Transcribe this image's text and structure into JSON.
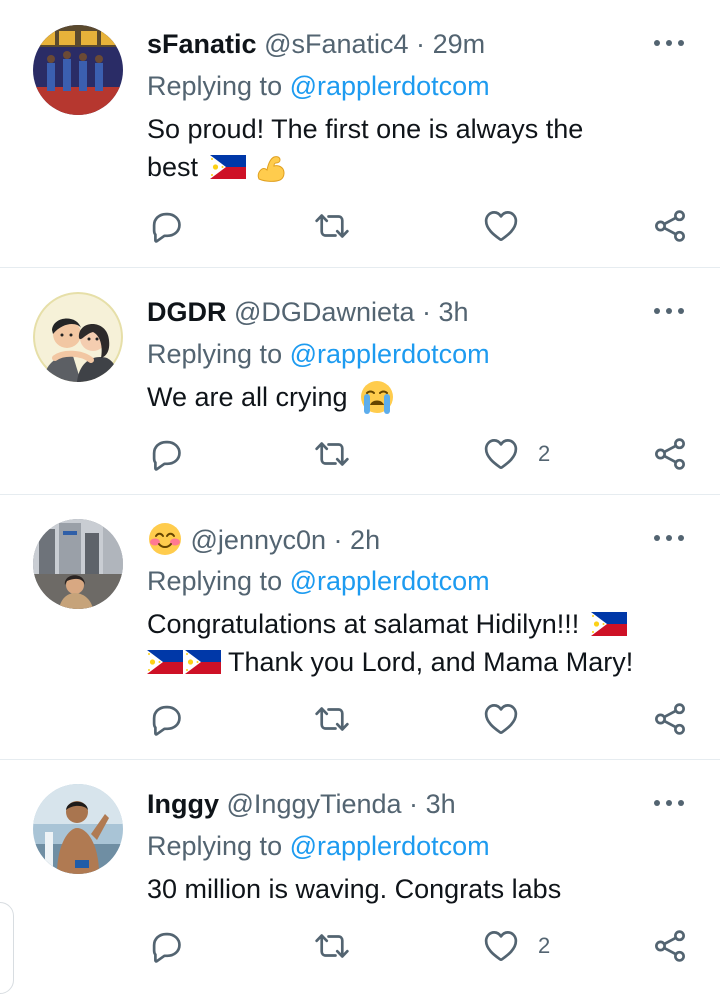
{
  "colors": {
    "text": "#0f1419",
    "muted": "#536471",
    "link": "#1d9bf0",
    "divider": "#e6ecf0",
    "icon": "#536471"
  },
  "tweets": [
    {
      "name": "sFanatic",
      "handle": "@sFanatic4",
      "separator": "·",
      "time": "29m",
      "replying_prefix": "Replying to",
      "replying_to": "@rapplerdotcom",
      "text_line1": "So proud! The first one is always the",
      "text_line2": "best",
      "emojis": [
        "philippines-flag-emoji",
        "flexed-biceps-emoji"
      ],
      "like_count": ""
    },
    {
      "name": "DGDR",
      "handle": "@DGDawnieta",
      "separator": "·",
      "time": "3h",
      "replying_prefix": "Replying to",
      "replying_to": "@rapplerdotcom",
      "text": "We are all crying",
      "emojis": [
        "loudly-crying-face-emoji"
      ],
      "like_count": "2"
    },
    {
      "name": "",
      "name_emoji": "smiling-face-with-hearts-emoji",
      "handle": "@jennyc0n",
      "separator": "·",
      "time": "2h",
      "replying_prefix": "Replying to",
      "replying_to": "@rapplerdotcom",
      "text_line1": "Congratulations at salamat Hidilyn!!!",
      "text_line2": "Thank you Lord, and Mama Mary!",
      "emojis": [
        "philippines-flag-emoji",
        "philippines-flag-emoji",
        "philippines-flag-emoji"
      ],
      "like_count": ""
    },
    {
      "name": "Inggy",
      "handle": "@InggyTienda",
      "separator": "·",
      "time": "3h",
      "replying_prefix": "Replying to",
      "replying_to": "@rapplerdotcom",
      "text": "30 million is waving. Congrats labs",
      "emojis": [],
      "like_count": "2"
    }
  ]
}
